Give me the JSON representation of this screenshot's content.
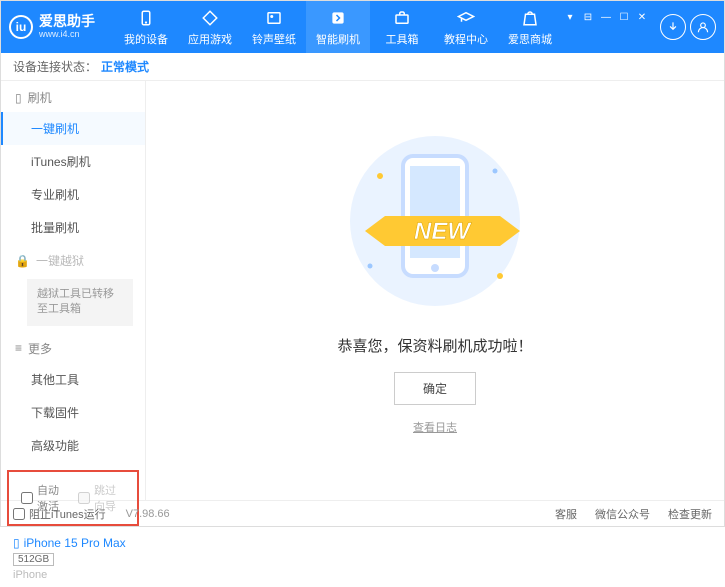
{
  "app": {
    "title": "爱思助手",
    "url": "www.i4.cn"
  },
  "nav": [
    {
      "label": "我的设备"
    },
    {
      "label": "应用游戏"
    },
    {
      "label": "铃声壁纸"
    },
    {
      "label": "智能刷机"
    },
    {
      "label": "工具箱"
    },
    {
      "label": "教程中心"
    },
    {
      "label": "爱思商城"
    }
  ],
  "status": {
    "label": "设备连接状态：",
    "mode": "正常模式"
  },
  "sidebar": {
    "group_flash": "刷机",
    "items_flash": [
      "一键刷机",
      "iTunes刷机",
      "专业刷机",
      "批量刷机"
    ],
    "group_jailbreak": "一键越狱",
    "jailbreak_note": "越狱工具已转移至工具箱",
    "group_more": "更多",
    "items_more": [
      "其他工具",
      "下载固件",
      "高级功能"
    ],
    "cb_auto": "自动激活",
    "cb_skip": "跳过向导"
  },
  "device": {
    "name": "iPhone 15 Pro Max",
    "storage": "512GB",
    "type": "iPhone"
  },
  "main": {
    "success": "恭喜您，保资料刷机成功啦！",
    "ok": "确定",
    "log": "查看日志"
  },
  "footer": {
    "block_itunes": "阻止iTunes运行",
    "version": "V7.98.66",
    "links": [
      "客服",
      "微信公众号",
      "检查更新"
    ]
  }
}
